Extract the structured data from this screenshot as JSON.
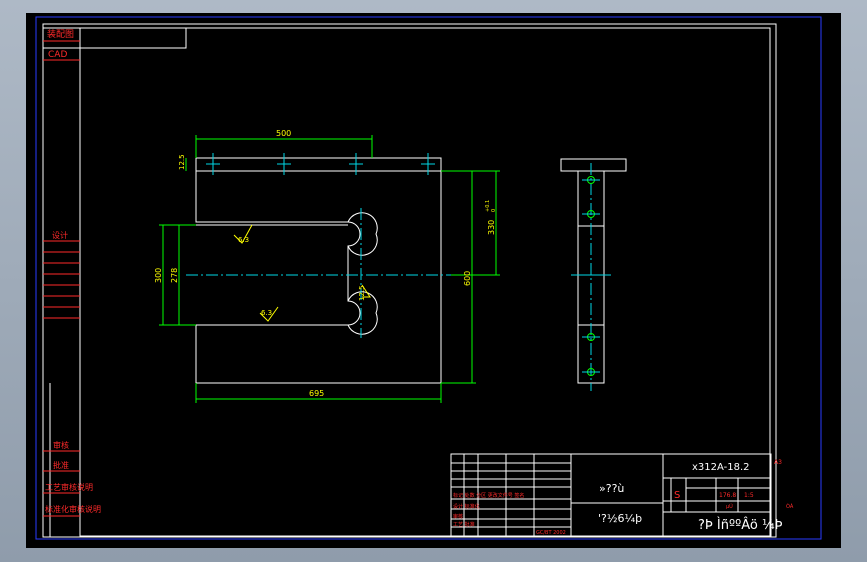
{
  "colors": {
    "frame_outer": "#2a3cff",
    "frame_inner": "#ffffff",
    "part": "#ffffff",
    "dimension": "#00ff00",
    "center": "#00d7e6",
    "annotation": "#ffff00",
    "left_strip_text": "#ff2a2a",
    "title_block": "#ffffff",
    "title_block_text_red": "#ff2a2a"
  },
  "left_strip": {
    "top_labels": [
      "装配图",
      "CAD"
    ],
    "mid_label": "设计",
    "bottom_labels": [
      "审核",
      "批准",
      "工艺审核说明",
      "标准化审核说明"
    ]
  },
  "dimensions": {
    "top_width": "500",
    "tab_height": "12.5",
    "right_height": "330",
    "right_tol_upper": "+0.1",
    "right_tol_lower": "0",
    "overall_height": "600",
    "slot_outer": "300",
    "slot_inner": "278",
    "slot_radius": "12.5",
    "bottom_width": "695"
  },
  "roughness": [
    "6.3",
    "6.3"
  ],
  "title_block": {
    "drawing_no": "x312A-18.2",
    "part_name": "»??ù",
    "material": "'?½6¼þ",
    "company": "?Þ ÌñººÂö ¼Þ",
    "scale": "1:5",
    "sheet_label": "A3",
    "weight": "176.8",
    "code": "S",
    "small_a": "ÒÀ",
    "small_b": "µÚ",
    "standard": "GC/BT 2002",
    "rows": [
      "标记 处数 分区 更改文件号 签名",
      "设计 标准化",
      "审核",
      "工艺 批准"
    ]
  }
}
